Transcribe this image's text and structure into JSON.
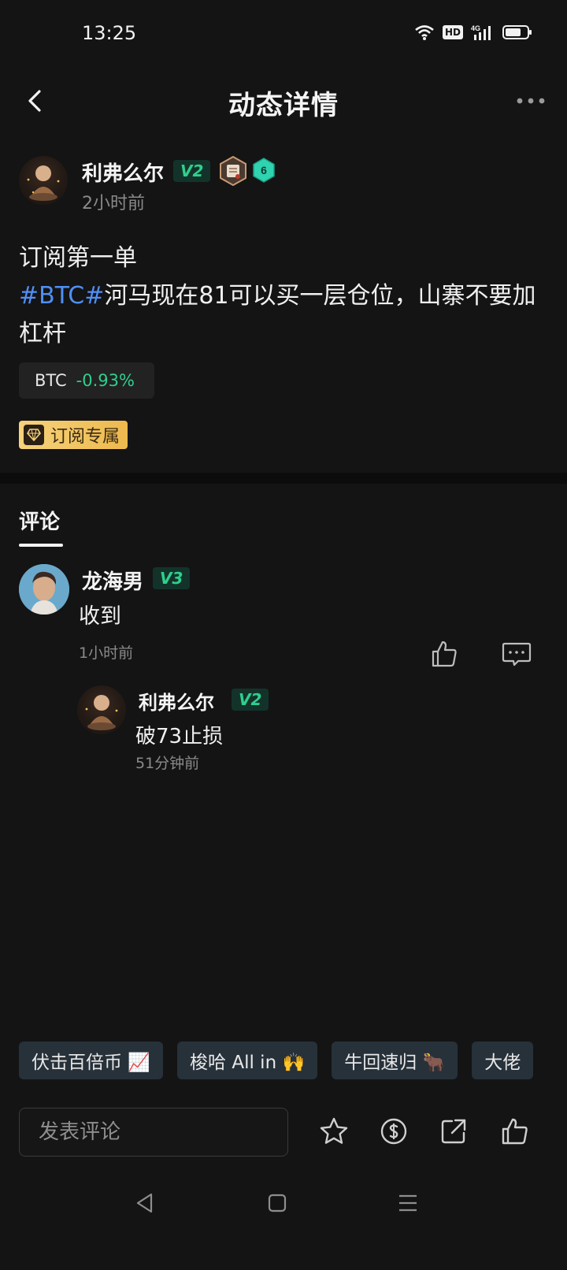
{
  "status_bar": {
    "time": "13:25",
    "network_badge": "HD",
    "signal": "4G"
  },
  "header": {
    "title": "动态详情",
    "back_icon": "back-arrow-icon",
    "more_icon": "more-dots-icon"
  },
  "post": {
    "author": {
      "name": "利弗么尔",
      "vip": "V2",
      "level": "6",
      "time": "2小时前"
    },
    "line1": "订阅第一单",
    "hashtag": "#BTC#",
    "line2": "河马现在81可以买一层仓位，山寨不要加杠杆",
    "ticker": {
      "symbol": "BTC",
      "change": "-0.93%",
      "change_color": "#2fcf8d"
    },
    "subscription_tag": "订阅专属"
  },
  "comments_section": {
    "tab_label": "评论",
    "comments": [
      {
        "name": "龙海男",
        "vip": "V3",
        "text": "收到",
        "time": "1小时前",
        "replies": [
          {
            "name": "利弗么尔",
            "vip": "V2",
            "text": "破73止损",
            "time": "51分钟前"
          }
        ]
      }
    ]
  },
  "quick_reactions": [
    "伏击百倍币 📈",
    "梭哈 All in 🙌",
    "牛回速归 🐂",
    "大佬"
  ],
  "bottom_bar": {
    "input_placeholder": "发表评论",
    "icons": [
      "star-icon",
      "coin-icon",
      "share-icon",
      "like-icon"
    ]
  },
  "system_nav": {
    "icons": [
      "back-triangle-icon",
      "home-square-icon",
      "menu-lines-icon"
    ]
  },
  "colors": {
    "accent_green": "#2fcf8d",
    "hashtag_blue": "#4f8ff7",
    "gold_tag": "#f6d27c",
    "background": "#141414"
  }
}
